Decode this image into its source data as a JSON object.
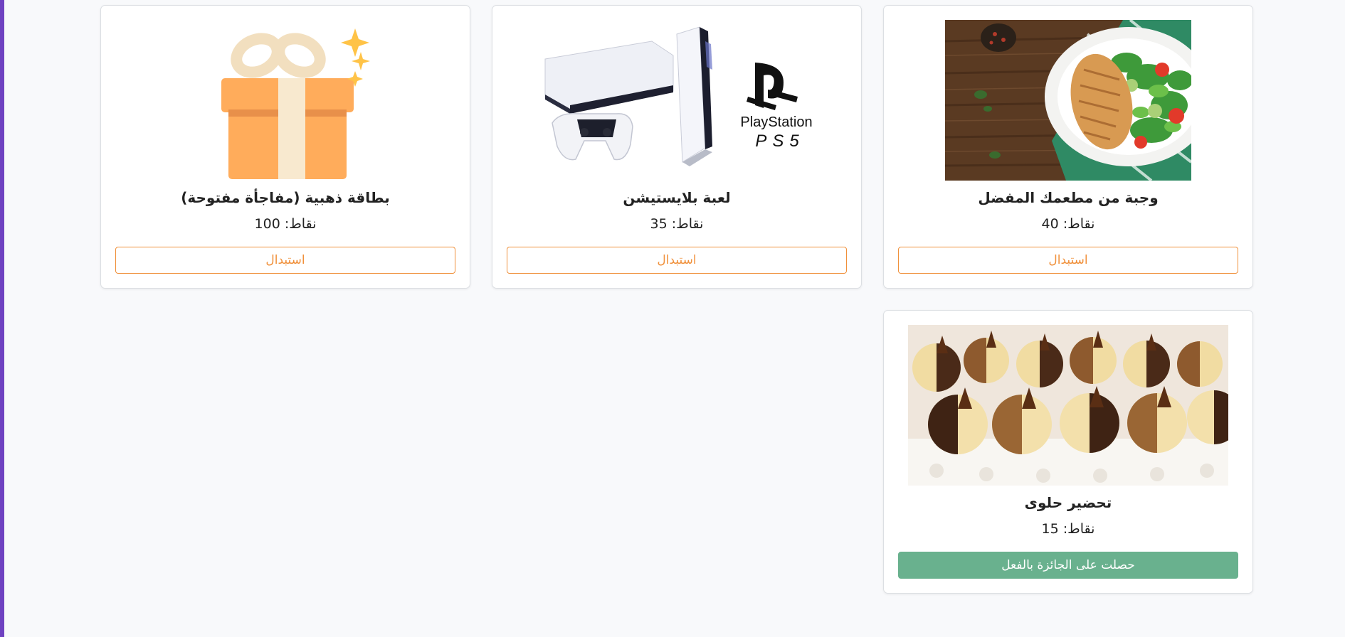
{
  "colors": {
    "accent_bar": "#6f42c1",
    "redeem_border": "#f0903a",
    "claimed_bg": "#69b18e"
  },
  "rewards": [
    {
      "title": "وجبة من مطعمك المفضل",
      "points": "نقاط: 40",
      "button": "استبدال",
      "image": "grilled-chicken-salad-plate",
      "claimed": false
    },
    {
      "title": "لعبة بلايستيشن",
      "points": "نقاط: 35",
      "button": "استبدال",
      "image": "playstation-5-console",
      "logo_text": "PlayStation",
      "logo_subtext": "PS5",
      "claimed": false
    },
    {
      "title": "بطاقة ذهبية (مفاجأة مفتوحة)",
      "points": "نقاط: 100",
      "button": "استبدال",
      "image": "gift-box-icon",
      "claimed": false
    },
    {
      "title": "تحضير حلوى",
      "points": "نقاط: 15",
      "button": "حصلت على الجائزة بالفعل",
      "image": "chocolate-cookies-tray",
      "claimed": true
    }
  ]
}
